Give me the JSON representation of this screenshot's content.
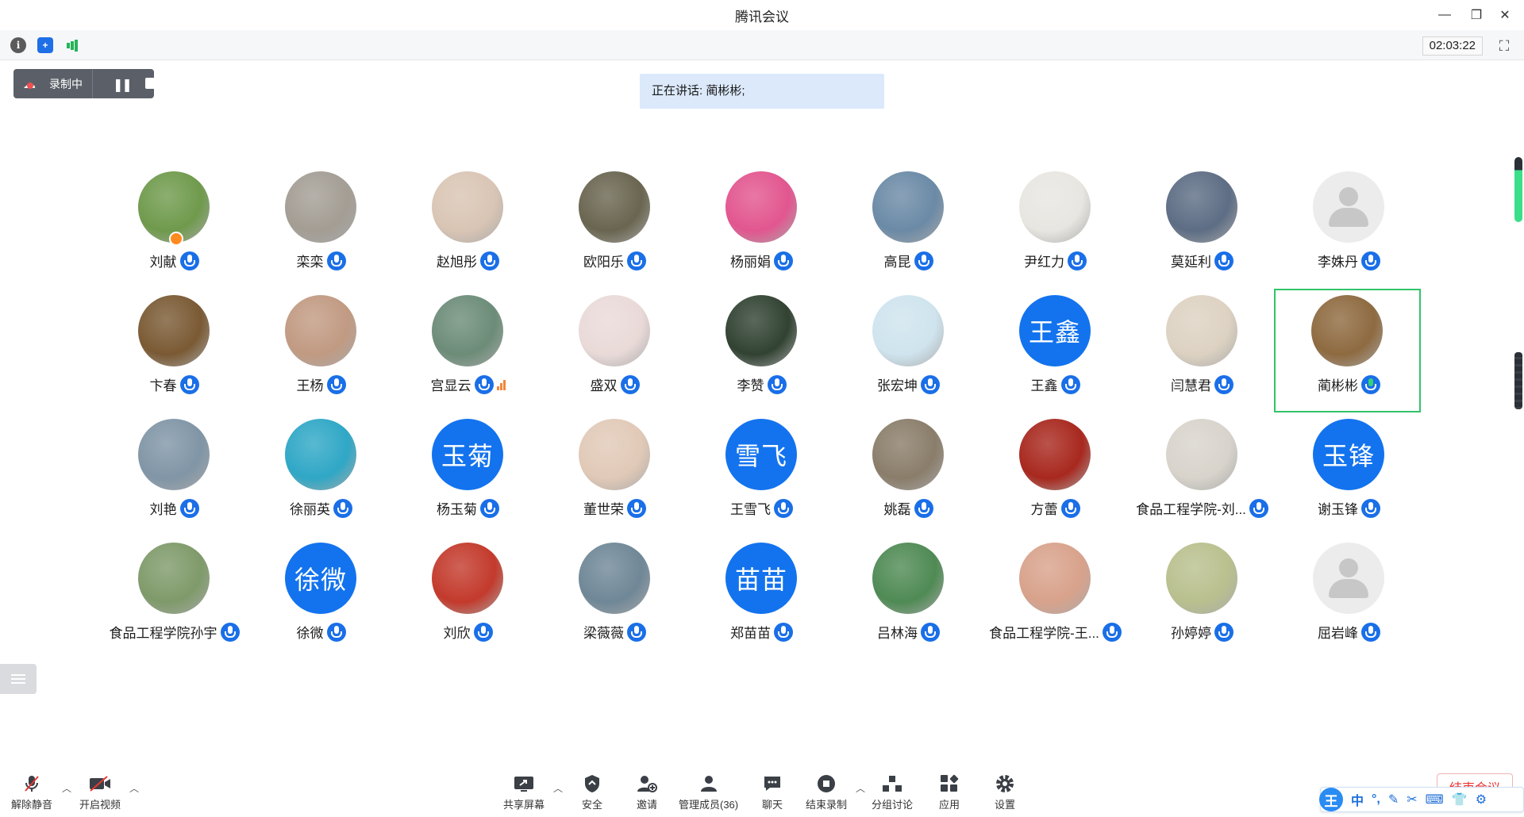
{
  "window": {
    "title": "腾讯会议"
  },
  "topbar": {
    "timer": "02:03:22"
  },
  "recording": {
    "label": "录制中"
  },
  "speaking": {
    "text": "正在讲话: 蔺彬彬;"
  },
  "participants": [
    {
      "name": "刘献",
      "avatar": "photo",
      "color": "#6f9a4c",
      "host": true
    },
    {
      "name": "栾栾",
      "avatar": "photo",
      "color": "#a39d94"
    },
    {
      "name": "赵旭彤",
      "avatar": "photo",
      "color": "#d9c5b4"
    },
    {
      "name": "欧阳乐",
      "avatar": "photo",
      "color": "#6a6550"
    },
    {
      "name": "杨丽娟",
      "avatar": "photo",
      "color": "#e2568f"
    },
    {
      "name": "高昆",
      "avatar": "photo",
      "color": "#6b8aa6"
    },
    {
      "name": "尹红力",
      "avatar": "photo",
      "color": "#e8e6e1"
    },
    {
      "name": "莫延利",
      "avatar": "photo",
      "color": "#5d6d84"
    },
    {
      "name": "李姝丹",
      "avatar": "placeholder"
    },
    {
      "name": "卞春",
      "avatar": "photo",
      "color": "#7a5a34"
    },
    {
      "name": "王杨",
      "avatar": "photo",
      "color": "#c19a82"
    },
    {
      "name": "宫显云",
      "avatar": "photo",
      "color": "#6c8c78",
      "signal": true
    },
    {
      "name": "盛双",
      "avatar": "photo",
      "color": "#e9dad8"
    },
    {
      "name": "李赞",
      "avatar": "photo",
      "color": "#314232"
    },
    {
      "name": "张宏坤",
      "avatar": "photo",
      "color": "#cfe4ee"
    },
    {
      "name": "王鑫",
      "avatar": "text",
      "initials": "王鑫"
    },
    {
      "name": "闫慧君",
      "avatar": "photo",
      "color": "#ddd2c2"
    },
    {
      "name": "蔺彬彬",
      "avatar": "photo",
      "color": "#8e6a40",
      "active": true
    },
    {
      "name": "刘艳",
      "avatar": "photo",
      "color": "#8095a6"
    },
    {
      "name": "徐丽英",
      "avatar": "photo",
      "color": "#2fa7c6"
    },
    {
      "name": "杨玉菊",
      "avatar": "text",
      "initials": "玉菊"
    },
    {
      "name": "董世荣",
      "avatar": "photo",
      "color": "#e1c9b7"
    },
    {
      "name": "王雪飞",
      "avatar": "text",
      "initials": "雪飞"
    },
    {
      "name": "姚磊",
      "avatar": "photo",
      "color": "#8a7d6a"
    },
    {
      "name": "方蕾",
      "avatar": "photo",
      "color": "#a8281e"
    },
    {
      "name": "食品工程学院-刘...",
      "avatar": "photo",
      "color": "#d8d4cc"
    },
    {
      "name": "谢玉锋",
      "avatar": "text",
      "initials": "玉锋"
    },
    {
      "name": "食品工程学院孙宇",
      "avatar": "photo",
      "color": "#7f9a6a"
    },
    {
      "name": "徐微",
      "avatar": "text",
      "initials": "徐微"
    },
    {
      "name": "刘欣",
      "avatar": "photo",
      "color": "#c33a2c"
    },
    {
      "name": "梁薇薇",
      "avatar": "photo",
      "color": "#6f8797"
    },
    {
      "name": "郑苗苗",
      "avatar": "text",
      "initials": "苗苗"
    },
    {
      "name": "吕林海",
      "avatar": "photo",
      "color": "#4f8a54"
    },
    {
      "name": "食品工程学院-王...",
      "avatar": "photo",
      "color": "#d8a28b"
    },
    {
      "name": "孙婷婷",
      "avatar": "photo",
      "color": "#b9c08e"
    },
    {
      "name": "屈岩峰",
      "avatar": "placeholder"
    }
  ],
  "toolbar": {
    "unmute": "解除静音",
    "video": "开启视频",
    "share": "共享屏幕",
    "security": "安全",
    "invite": "邀请",
    "members": "管理成员(36)",
    "chat": "聊天",
    "end_record": "结束录制",
    "breakout": "分组讨论",
    "apps": "应用",
    "settings": "设置",
    "end_meeting": "结束会议"
  },
  "ime": {
    "logo": "王",
    "mode": "中"
  }
}
